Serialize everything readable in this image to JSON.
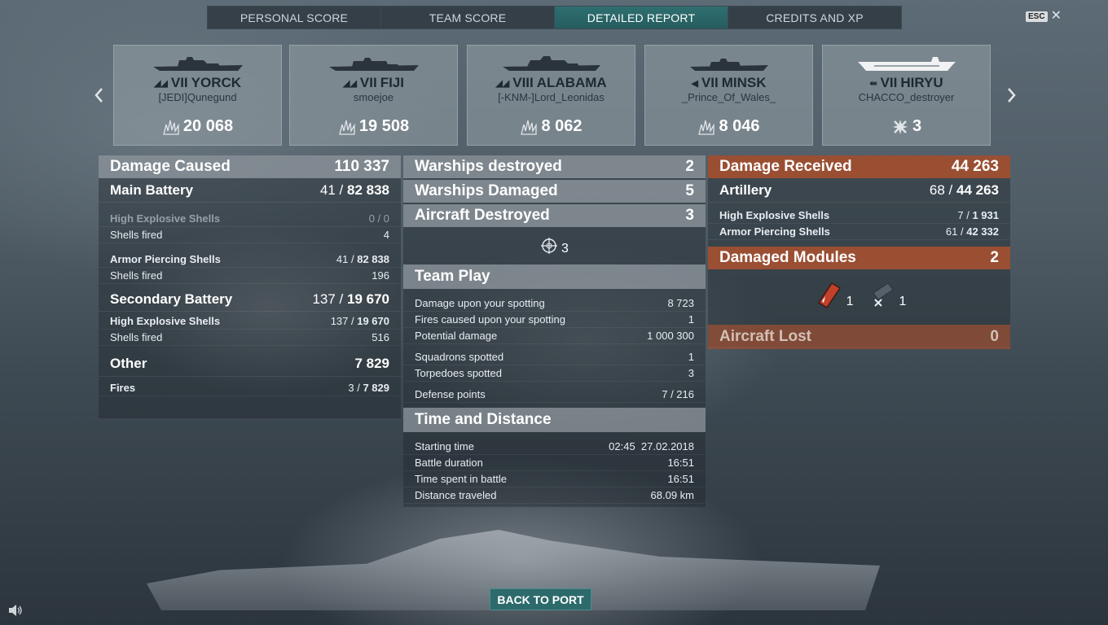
{
  "tabs": [
    {
      "label": "PERSONAL SCORE"
    },
    {
      "label": "TEAM SCORE"
    },
    {
      "label": "DETAILED REPORT"
    },
    {
      "label": "CREDITS AND XP"
    }
  ],
  "esc": {
    "key": "ESC",
    "close": "✕"
  },
  "ships": [
    {
      "tier": "VII",
      "name": "YORCK",
      "player": "[JEDI]Qunegund",
      "score": "20 068",
      "icon": "damage-icon"
    },
    {
      "tier": "VII",
      "name": "FIJI",
      "player": "smoejoe",
      "score": "19 508",
      "icon": "damage-icon"
    },
    {
      "tier": "VIII",
      "name": "ALABAMA",
      "player": "[-KNM-]Lord_Leonidas",
      "score": "8 062",
      "icon": "damage-icon"
    },
    {
      "tier": "VII",
      "name": "MINSK",
      "player": "_Prince_Of_Wales_",
      "score": "8 046",
      "icon": "damage-icon"
    },
    {
      "tier": "VII",
      "name": "HIRYU",
      "player": "CHACCO_destroyer",
      "score": "3",
      "icon": "plane-destroyed-icon"
    }
  ],
  "left": {
    "damage_caused": {
      "label": "Damage Caused",
      "value": "110 337"
    },
    "main_battery": {
      "label": "Main Battery",
      "a": "41",
      "b": "82 838"
    },
    "mb_he": {
      "label": "High Explosive Shells",
      "value": "0 / 0"
    },
    "mb_he_fired": {
      "label": "Shells fired",
      "value": "4"
    },
    "mb_ap": {
      "label": "Armor Piercing Shells",
      "a": "41",
      "b": "82 838"
    },
    "mb_ap_fired": {
      "label": "Shells fired",
      "value": "196"
    },
    "secondary": {
      "label": "Secondary Battery",
      "a": "137",
      "b": "19 670"
    },
    "sec_he": {
      "label": "High Explosive Shells",
      "a": "137",
      "b": "19 670"
    },
    "sec_fired": {
      "label": "Shells fired",
      "value": "516"
    },
    "other": {
      "label": "Other",
      "value": "7 829"
    },
    "fires": {
      "label": "Fires",
      "a": "3",
      "b": "7 829"
    }
  },
  "middle": {
    "warships_destroyed": {
      "label": "Warships destroyed",
      "value": "2"
    },
    "warships_damaged": {
      "label": "Warships Damaged",
      "value": "5"
    },
    "aircraft_destroyed": {
      "label": "Aircraft Destroyed",
      "value": "3"
    },
    "aircraft_icon_count": "3",
    "team_play": {
      "label": "Team Play"
    },
    "tp_rows": [
      {
        "label": "Damage upon your spotting",
        "value": "8 723"
      },
      {
        "label": "Fires caused upon your spotting",
        "value": "1"
      },
      {
        "label": "Potential damage",
        "value": "1 000 300"
      },
      {
        "label": "Squadrons spotted",
        "value": "1"
      },
      {
        "label": "Torpedoes spotted",
        "value": "3"
      },
      {
        "label": "Defense points",
        "value": "7 / 216"
      }
    ],
    "time_distance": {
      "label": "Time and Distance"
    },
    "td_rows": [
      {
        "label": "Starting time",
        "value": "02:45  27.02.2018"
      },
      {
        "label": "Battle duration",
        "value": "16:51"
      },
      {
        "label": "Time spent in battle",
        "value": "16:51"
      },
      {
        "label": "Distance traveled",
        "value": "68.09 km"
      }
    ]
  },
  "right": {
    "damage_received": {
      "label": "Damage Received",
      "value": "44 263"
    },
    "artillery": {
      "label": "Artillery",
      "a": "68",
      "b": "44 263"
    },
    "he": {
      "label": "High Explosive Shells",
      "a": "7",
      "b": "1 931"
    },
    "ap": {
      "label": "Armor Piercing Shells",
      "a": "61",
      "b": "42 332"
    },
    "damaged_modules": {
      "label": "Damaged Modules",
      "value": "2"
    },
    "module_a": "1",
    "module_b": "1",
    "aircraft_lost": {
      "label": "Aircraft Lost",
      "value": "0"
    }
  },
  "back_button": "BACK TO PORT",
  "colors": {
    "accent": "#2e6f70",
    "received": "#9a4f33"
  }
}
